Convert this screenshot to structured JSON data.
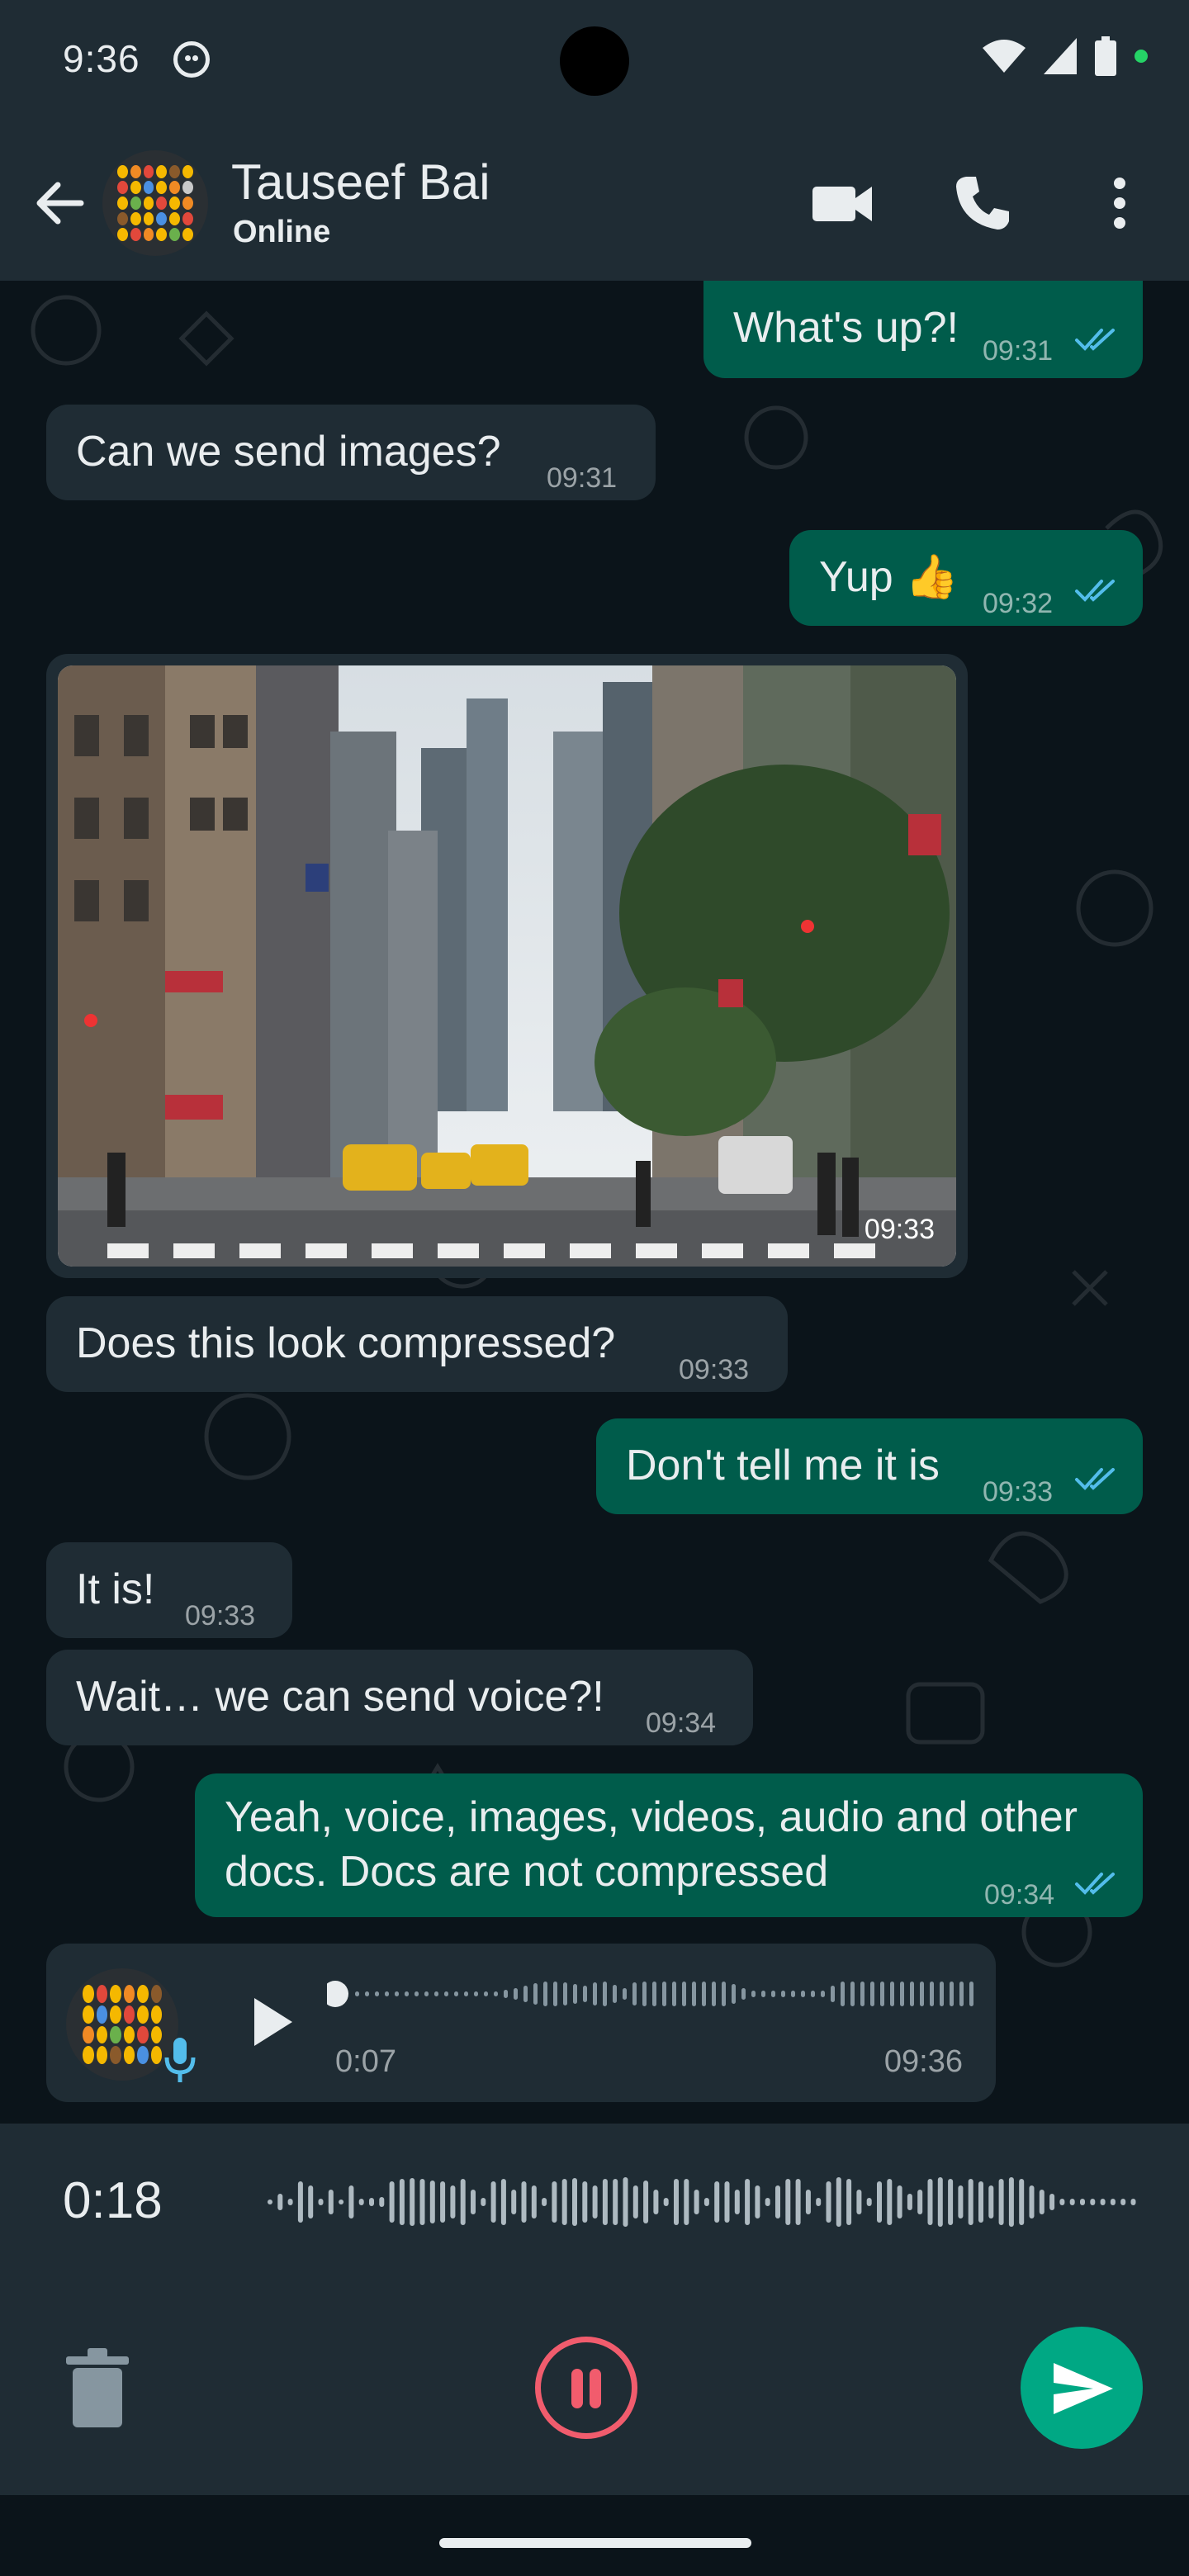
{
  "status_bar": {
    "time": "9:36"
  },
  "header": {
    "name": "Tauseef Bai",
    "status": "Online"
  },
  "messages": [
    {
      "dir": "out",
      "text": "What's up?!",
      "time": "09:31"
    },
    {
      "dir": "in",
      "text": "Can we send images?",
      "time": "09:31"
    },
    {
      "dir": "out",
      "text": "Yup 👍",
      "time": "09:32"
    },
    {
      "dir": "in",
      "type": "image",
      "time": "09:33"
    },
    {
      "dir": "in",
      "text": "Does this look compressed?",
      "time": "09:33"
    },
    {
      "dir": "out",
      "text": "Don't tell me it is",
      "time": "09:33"
    },
    {
      "dir": "in",
      "text": "It is!",
      "time": "09:33"
    },
    {
      "dir": "in",
      "text": "Wait… we can send voice?!",
      "time": "09:34"
    },
    {
      "dir": "out",
      "text_line1": "Yeah, voice, images, videos, audio and other",
      "text_line2": "docs. Docs are not compressed",
      "time": "09:34"
    },
    {
      "dir": "in",
      "type": "voice",
      "duration": "0:07",
      "time": "09:36",
      "progress": 0
    }
  ],
  "recording": {
    "elapsed": "0:18"
  },
  "colors": {
    "incoming_bubble": "#1f2c34",
    "outgoing_bubble": "#005c4b",
    "send_button": "#00a884",
    "pause_button": "#f15c6d",
    "read_ticks": "#53bdeb"
  }
}
